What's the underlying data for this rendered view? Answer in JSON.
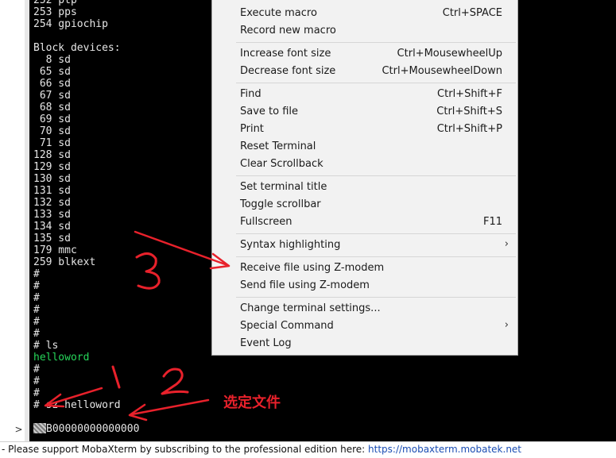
{
  "terminal": {
    "lines": [
      {
        "text": "252 ptp"
      },
      {
        "text": "253 pps"
      },
      {
        "text": "254 gpiochip"
      },
      {
        "text": ""
      },
      {
        "text": "Block devices:"
      },
      {
        "text": "  8 sd"
      },
      {
        "text": " 65 sd"
      },
      {
        "text": " 66 sd"
      },
      {
        "text": " 67 sd"
      },
      {
        "text": " 68 sd"
      },
      {
        "text": " 69 sd"
      },
      {
        "text": " 70 sd"
      },
      {
        "text": " 71 sd"
      },
      {
        "text": "128 sd"
      },
      {
        "text": "129 sd"
      },
      {
        "text": "130 sd"
      },
      {
        "text": "131 sd"
      },
      {
        "text": "132 sd"
      },
      {
        "text": "133 sd"
      },
      {
        "text": "134 sd"
      },
      {
        "text": "135 sd"
      },
      {
        "text": "179 mmc"
      },
      {
        "text": "259 blkext"
      },
      {
        "text": "#"
      },
      {
        "text": "#"
      },
      {
        "text": "#"
      },
      {
        "text": "#"
      },
      {
        "text": "#"
      },
      {
        "text": "#"
      },
      {
        "text": "# ls"
      },
      {
        "text": "helloword",
        "color": "green"
      },
      {
        "text": "#"
      },
      {
        "text": "#"
      },
      {
        "text": "#"
      },
      {
        "text": "# sz helloword"
      }
    ],
    "zmodem_output": "B00000000000000"
  },
  "left_panel": {
    "arrow_icon": "chevron-right-icon",
    "arrow_glyph": ">"
  },
  "context_menu": {
    "items": [
      {
        "label": "Execute macro",
        "shortcut": "Ctrl+SPACE"
      },
      {
        "label": "Record new macro",
        "shortcut": ""
      },
      {
        "separator": true
      },
      {
        "label": "Increase font size",
        "shortcut": "Ctrl+MousewheelUp"
      },
      {
        "label": "Decrease font size",
        "shortcut": "Ctrl+MousewheelDown"
      },
      {
        "separator": true
      },
      {
        "label": "Find",
        "shortcut": "Ctrl+Shift+F"
      },
      {
        "label": "Save to file",
        "shortcut": "Ctrl+Shift+S"
      },
      {
        "label": "Print",
        "shortcut": "Ctrl+Shift+P"
      },
      {
        "label": "Reset Terminal",
        "shortcut": ""
      },
      {
        "label": "Clear Scrollback",
        "shortcut": ""
      },
      {
        "separator": true
      },
      {
        "label": "Set terminal title",
        "shortcut": ""
      },
      {
        "label": "Toggle scrollbar",
        "shortcut": ""
      },
      {
        "label": "Fullscreen",
        "shortcut": "F11"
      },
      {
        "separator": true
      },
      {
        "label": "Syntax highlighting",
        "shortcut": "",
        "submenu": true
      },
      {
        "separator": true
      },
      {
        "label": "Receive file using Z-modem",
        "shortcut": ""
      },
      {
        "label": "Send file using Z-modem",
        "shortcut": ""
      },
      {
        "separator": true
      },
      {
        "label": "Change terminal settings...",
        "shortcut": ""
      },
      {
        "label": "Special Command",
        "shortcut": "",
        "submenu": true
      },
      {
        "label": "Event Log",
        "shortcut": ""
      }
    ],
    "submenu_glyph": "›"
  },
  "annotations": {
    "color": "#e8212b",
    "number_1": "1",
    "number_2": "2",
    "number_3": "3",
    "select_file_label": "选定文件"
  },
  "status_bar": {
    "text": "- Please support MobaXterm by subscribing to the professional edition here:  ",
    "link": "https://mobaxterm.mobatek.net"
  }
}
